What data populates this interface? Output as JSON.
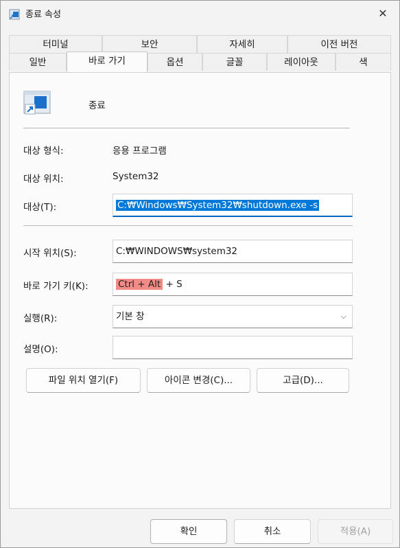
{
  "window": {
    "title": "종료 속성",
    "close_icon": "close-icon"
  },
  "tabs_row1": [
    "터미널",
    "보안",
    "자세히",
    "이전 버전"
  ],
  "tabs_row2": [
    "일반",
    "바로 가기",
    "옵션",
    "글꼴",
    "레이아웃",
    "색"
  ],
  "active_tab": "바로 가기",
  "shortcut": {
    "app_name": "종료",
    "target_type_label": "대상 형식:",
    "target_type_value": "응용 프로그램",
    "target_location_label": "대상 위치:",
    "target_location_value": "System32",
    "target_label": "대상(T):",
    "target_value": "C:₩Windows₩System32₩shutdown.exe -s",
    "start_in_label": "시작 위치(S):",
    "start_in_value": "C:₩WINDOWS₩system32",
    "hotkey_label": "바로 가기 키(K):",
    "hotkey_highlight": "Ctrl + Alt",
    "hotkey_rest": " + S",
    "run_label": "실행(R):",
    "run_value": "기본 창",
    "comment_label": "설명(O):",
    "comment_value": ""
  },
  "buttons": {
    "open_location": "파일 위치 열기(F)",
    "change_icon": "아이콘 변경(C)...",
    "advanced": "고급(D)..."
  },
  "footer": {
    "ok": "확인",
    "cancel": "취소",
    "apply": "적용(A)"
  },
  "colors": {
    "selection": "#0078d7",
    "hotkey_highlight": "#f28b86",
    "focus_underline": "#0067c0"
  }
}
